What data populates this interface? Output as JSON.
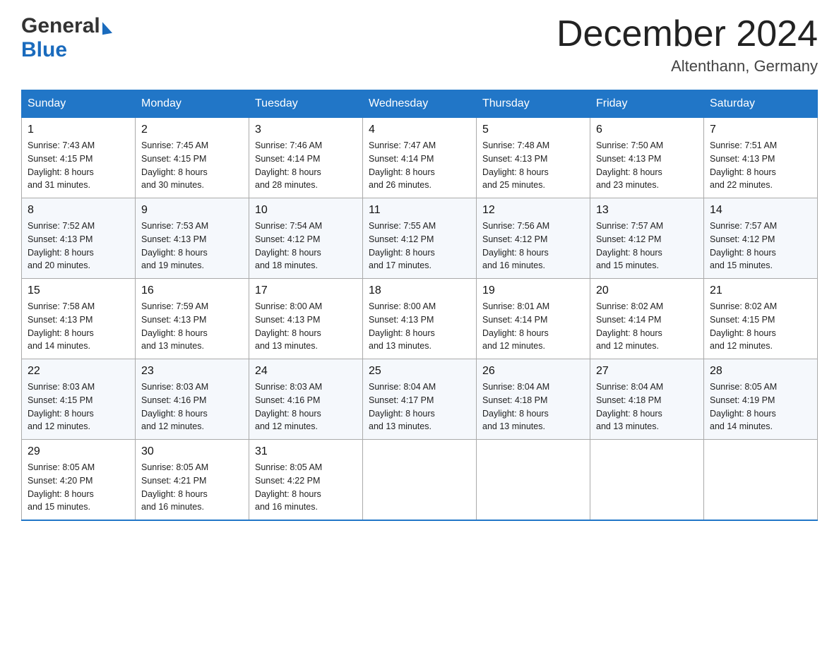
{
  "header": {
    "logo_general": "General",
    "logo_blue": "Blue",
    "month_title": "December 2024",
    "location": "Altenthann, Germany"
  },
  "days_of_week": [
    "Sunday",
    "Monday",
    "Tuesday",
    "Wednesday",
    "Thursday",
    "Friday",
    "Saturday"
  ],
  "weeks": [
    [
      {
        "day": "1",
        "sunrise": "7:43 AM",
        "sunset": "4:15 PM",
        "daylight": "8 hours and 31 minutes."
      },
      {
        "day": "2",
        "sunrise": "7:45 AM",
        "sunset": "4:15 PM",
        "daylight": "8 hours and 30 minutes."
      },
      {
        "day": "3",
        "sunrise": "7:46 AM",
        "sunset": "4:14 PM",
        "daylight": "8 hours and 28 minutes."
      },
      {
        "day": "4",
        "sunrise": "7:47 AM",
        "sunset": "4:14 PM",
        "daylight": "8 hours and 26 minutes."
      },
      {
        "day": "5",
        "sunrise": "7:48 AM",
        "sunset": "4:13 PM",
        "daylight": "8 hours and 25 minutes."
      },
      {
        "day": "6",
        "sunrise": "7:50 AM",
        "sunset": "4:13 PM",
        "daylight": "8 hours and 23 minutes."
      },
      {
        "day": "7",
        "sunrise": "7:51 AM",
        "sunset": "4:13 PM",
        "daylight": "8 hours and 22 minutes."
      }
    ],
    [
      {
        "day": "8",
        "sunrise": "7:52 AM",
        "sunset": "4:13 PM",
        "daylight": "8 hours and 20 minutes."
      },
      {
        "day": "9",
        "sunrise": "7:53 AM",
        "sunset": "4:13 PM",
        "daylight": "8 hours and 19 minutes."
      },
      {
        "day": "10",
        "sunrise": "7:54 AM",
        "sunset": "4:12 PM",
        "daylight": "8 hours and 18 minutes."
      },
      {
        "day": "11",
        "sunrise": "7:55 AM",
        "sunset": "4:12 PM",
        "daylight": "8 hours and 17 minutes."
      },
      {
        "day": "12",
        "sunrise": "7:56 AM",
        "sunset": "4:12 PM",
        "daylight": "8 hours and 16 minutes."
      },
      {
        "day": "13",
        "sunrise": "7:57 AM",
        "sunset": "4:12 PM",
        "daylight": "8 hours and 15 minutes."
      },
      {
        "day": "14",
        "sunrise": "7:57 AM",
        "sunset": "4:12 PM",
        "daylight": "8 hours and 15 minutes."
      }
    ],
    [
      {
        "day": "15",
        "sunrise": "7:58 AM",
        "sunset": "4:13 PM",
        "daylight": "8 hours and 14 minutes."
      },
      {
        "day": "16",
        "sunrise": "7:59 AM",
        "sunset": "4:13 PM",
        "daylight": "8 hours and 13 minutes."
      },
      {
        "day": "17",
        "sunrise": "8:00 AM",
        "sunset": "4:13 PM",
        "daylight": "8 hours and 13 minutes."
      },
      {
        "day": "18",
        "sunrise": "8:00 AM",
        "sunset": "4:13 PM",
        "daylight": "8 hours and 13 minutes."
      },
      {
        "day": "19",
        "sunrise": "8:01 AM",
        "sunset": "4:14 PM",
        "daylight": "8 hours and 12 minutes."
      },
      {
        "day": "20",
        "sunrise": "8:02 AM",
        "sunset": "4:14 PM",
        "daylight": "8 hours and 12 minutes."
      },
      {
        "day": "21",
        "sunrise": "8:02 AM",
        "sunset": "4:15 PM",
        "daylight": "8 hours and 12 minutes."
      }
    ],
    [
      {
        "day": "22",
        "sunrise": "8:03 AM",
        "sunset": "4:15 PM",
        "daylight": "8 hours and 12 minutes."
      },
      {
        "day": "23",
        "sunrise": "8:03 AM",
        "sunset": "4:16 PM",
        "daylight": "8 hours and 12 minutes."
      },
      {
        "day": "24",
        "sunrise": "8:03 AM",
        "sunset": "4:16 PM",
        "daylight": "8 hours and 12 minutes."
      },
      {
        "day": "25",
        "sunrise": "8:04 AM",
        "sunset": "4:17 PM",
        "daylight": "8 hours and 13 minutes."
      },
      {
        "day": "26",
        "sunrise": "8:04 AM",
        "sunset": "4:18 PM",
        "daylight": "8 hours and 13 minutes."
      },
      {
        "day": "27",
        "sunrise": "8:04 AM",
        "sunset": "4:18 PM",
        "daylight": "8 hours and 13 minutes."
      },
      {
        "day": "28",
        "sunrise": "8:05 AM",
        "sunset": "4:19 PM",
        "daylight": "8 hours and 14 minutes."
      }
    ],
    [
      {
        "day": "29",
        "sunrise": "8:05 AM",
        "sunset": "4:20 PM",
        "daylight": "8 hours and 15 minutes."
      },
      {
        "day": "30",
        "sunrise": "8:05 AM",
        "sunset": "4:21 PM",
        "daylight": "8 hours and 16 minutes."
      },
      {
        "day": "31",
        "sunrise": "8:05 AM",
        "sunset": "4:22 PM",
        "daylight": "8 hours and 16 minutes."
      },
      null,
      null,
      null,
      null
    ]
  ],
  "labels": {
    "sunrise": "Sunrise:",
    "sunset": "Sunset:",
    "daylight": "Daylight:"
  }
}
